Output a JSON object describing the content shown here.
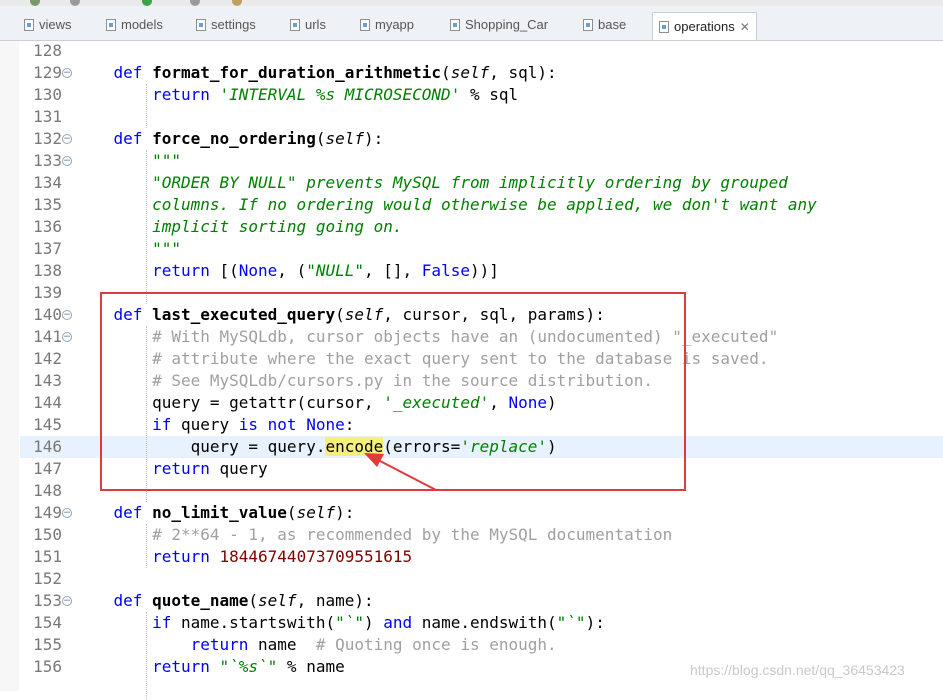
{
  "tabs": [
    {
      "label": "views",
      "active": false
    },
    {
      "label": "models",
      "active": false
    },
    {
      "label": "settings",
      "active": false
    },
    {
      "label": "urls",
      "active": false
    },
    {
      "label": "myapp",
      "active": false
    },
    {
      "label": "Shopping_Car",
      "active": false
    },
    {
      "label": "base",
      "active": false
    },
    {
      "label": "operations",
      "active": true
    }
  ],
  "close_glyph": "✕",
  "lines": [
    {
      "n": "128",
      "fold": false,
      "tokens": []
    },
    {
      "n": "129",
      "fold": true,
      "tokens": [
        [
          "i",
          "    "
        ],
        [
          "kw",
          "def "
        ],
        [
          "fn",
          "format_for_duration_arithmetic"
        ],
        [
          "p",
          "("
        ],
        [
          "slf",
          "self"
        ],
        [
          "p",
          ", sql):"
        ]
      ]
    },
    {
      "n": "130",
      "fold": false,
      "tokens": [
        [
          "i",
          "        "
        ],
        [
          "kw",
          "return "
        ],
        [
          "str",
          "'INTERVAL %s MICROSECOND'"
        ],
        [
          "p",
          " % sql"
        ]
      ]
    },
    {
      "n": "131",
      "fold": false,
      "tokens": []
    },
    {
      "n": "132",
      "fold": true,
      "tokens": [
        [
          "i",
          "    "
        ],
        [
          "kw",
          "def "
        ],
        [
          "fn",
          "force_no_ordering"
        ],
        [
          "p",
          "("
        ],
        [
          "slf",
          "self"
        ],
        [
          "p",
          "):"
        ]
      ]
    },
    {
      "n": "133",
      "fold": true,
      "tokens": [
        [
          "i",
          "        "
        ],
        [
          "dq",
          "\"\"\""
        ]
      ]
    },
    {
      "n": "134",
      "fold": false,
      "tokens": [
        [
          "i",
          "        "
        ],
        [
          "dq",
          "\"ORDER BY NULL\" prevents MySQL from implicitly ordering by grouped"
        ]
      ]
    },
    {
      "n": "135",
      "fold": false,
      "tokens": [
        [
          "i",
          "        "
        ],
        [
          "dq",
          "columns. If no ordering would otherwise be applied, we don't want any"
        ]
      ]
    },
    {
      "n": "136",
      "fold": false,
      "tokens": [
        [
          "i",
          "        "
        ],
        [
          "dq",
          "implicit sorting going on."
        ]
      ]
    },
    {
      "n": "137",
      "fold": false,
      "tokens": [
        [
          "i",
          "        "
        ],
        [
          "dq",
          "\"\"\""
        ]
      ]
    },
    {
      "n": "138",
      "fold": false,
      "tokens": [
        [
          "i",
          "        "
        ],
        [
          "kw",
          "return "
        ],
        [
          "p",
          "[("
        ],
        [
          "kw",
          "None"
        ],
        [
          "p",
          ", ("
        ],
        [
          "str",
          "\"NULL\""
        ],
        [
          "p",
          ", [], "
        ],
        [
          "kw",
          "False"
        ],
        [
          "p",
          "))]"
        ]
      ]
    },
    {
      "n": "139",
      "fold": false,
      "tokens": []
    },
    {
      "n": "140",
      "fold": true,
      "tokens": [
        [
          "i",
          "    "
        ],
        [
          "kw",
          "def "
        ],
        [
          "fn",
          "last_executed_query"
        ],
        [
          "p",
          "("
        ],
        [
          "slf",
          "self"
        ],
        [
          "p",
          ", cursor, sql, params):"
        ]
      ]
    },
    {
      "n": "141",
      "fold": true,
      "tokens": [
        [
          "i",
          "        "
        ],
        [
          "cmt",
          "# With MySQLdb, cursor objects have an (undocumented) \"_executed\""
        ]
      ]
    },
    {
      "n": "142",
      "fold": false,
      "tokens": [
        [
          "i",
          "        "
        ],
        [
          "cmt",
          "# attribute where the exact query sent to the database is saved."
        ]
      ]
    },
    {
      "n": "143",
      "fold": false,
      "tokens": [
        [
          "i",
          "        "
        ],
        [
          "cmt",
          "# See MySQLdb/cursors.py in the source distribution."
        ]
      ]
    },
    {
      "n": "144",
      "fold": false,
      "tokens": [
        [
          "i",
          "        "
        ],
        [
          "p",
          "query = getattr(cursor, "
        ],
        [
          "str",
          "'_executed'"
        ],
        [
          "p",
          ", "
        ],
        [
          "kw",
          "None"
        ],
        [
          "p",
          ")"
        ]
      ]
    },
    {
      "n": "145",
      "fold": false,
      "tokens": [
        [
          "i",
          "        "
        ],
        [
          "kw",
          "if "
        ],
        [
          "p",
          "query "
        ],
        [
          "kw",
          "is not None"
        ],
        [
          "p",
          ":"
        ]
      ]
    },
    {
      "n": "146",
      "fold": false,
      "cur": true,
      "tokens": [
        [
          "i",
          "            "
        ],
        [
          "p",
          "query = query."
        ],
        [
          "hl",
          "encode"
        ],
        [
          "p",
          "(errors="
        ],
        [
          "str",
          "'replace'"
        ],
        [
          "p",
          ")"
        ]
      ]
    },
    {
      "n": "147",
      "fold": false,
      "tokens": [
        [
          "i",
          "        "
        ],
        [
          "kw",
          "return "
        ],
        [
          "p",
          "query"
        ]
      ]
    },
    {
      "n": "148",
      "fold": false,
      "tokens": []
    },
    {
      "n": "149",
      "fold": true,
      "tokens": [
        [
          "i",
          "    "
        ],
        [
          "kw",
          "def "
        ],
        [
          "fn",
          "no_limit_value"
        ],
        [
          "p",
          "("
        ],
        [
          "slf",
          "self"
        ],
        [
          "p",
          "):"
        ]
      ]
    },
    {
      "n": "150",
      "fold": false,
      "tokens": [
        [
          "i",
          "        "
        ],
        [
          "cmt",
          "# 2**64 - 1, as recommended by the MySQL documentation"
        ]
      ]
    },
    {
      "n": "151",
      "fold": false,
      "tokens": [
        [
          "i",
          "        "
        ],
        [
          "kw",
          "return "
        ],
        [
          "num",
          "18446744073709551615"
        ]
      ]
    },
    {
      "n": "152",
      "fold": false,
      "tokens": []
    },
    {
      "n": "153",
      "fold": true,
      "tokens": [
        [
          "i",
          "    "
        ],
        [
          "kw",
          "def "
        ],
        [
          "fn",
          "quote_name"
        ],
        [
          "p",
          "("
        ],
        [
          "slf",
          "self"
        ],
        [
          "p",
          ", name):"
        ]
      ]
    },
    {
      "n": "154",
      "fold": false,
      "tokens": [
        [
          "i",
          "        "
        ],
        [
          "kw",
          "if "
        ],
        [
          "p",
          "name.startswith("
        ],
        [
          "str",
          "\"`\""
        ],
        [
          "p",
          ") "
        ],
        [
          "kw",
          "and "
        ],
        [
          "p",
          "name.endswith("
        ],
        [
          "str",
          "\"`\""
        ],
        [
          "p",
          "):"
        ]
      ]
    },
    {
      "n": "155",
      "fold": false,
      "tokens": [
        [
          "i",
          "            "
        ],
        [
          "kw",
          "return "
        ],
        [
          "p",
          "name  "
        ],
        [
          "cmt",
          "# Quoting once is enough."
        ]
      ]
    },
    {
      "n": "156",
      "fold": false,
      "tokens": [
        [
          "i",
          "        "
        ],
        [
          "kw",
          "return "
        ],
        [
          "str",
          "\"`%s`\""
        ],
        [
          "p",
          " % name"
        ]
      ]
    }
  ],
  "watermark": "https://blog.csdn.net/qq_36453423"
}
